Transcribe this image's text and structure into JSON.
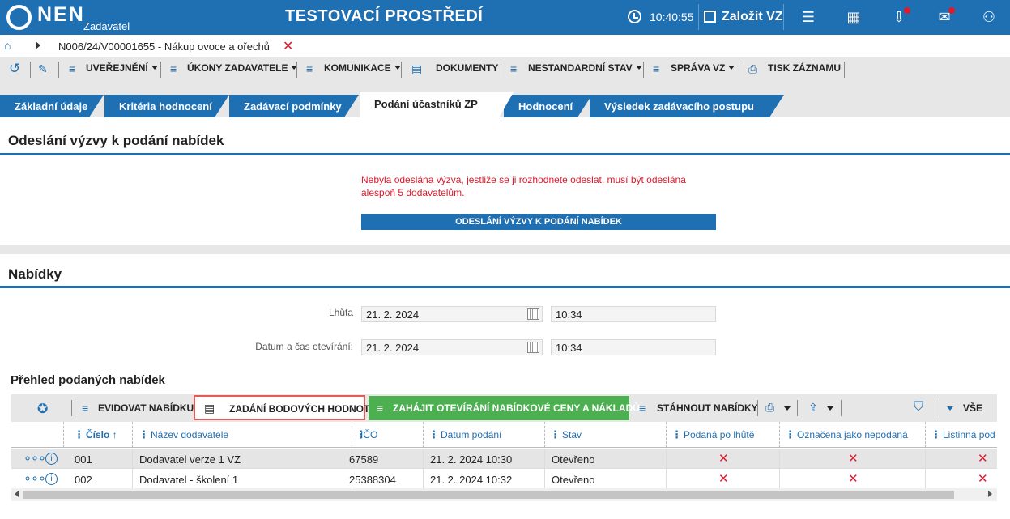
{
  "header": {
    "logo_text": "NEN",
    "logo_sub": "Zadavatel",
    "env_title": "TESTOVACÍ PROSTŘEDÍ",
    "clock": "10:40:55",
    "create_label": "Založit VZ",
    "icons": [
      "menu-icon",
      "calculator-icon",
      "inbox-icon",
      "mail-icon",
      "user-icon"
    ]
  },
  "breadcrumb": {
    "text": "N006/24/V00001655 - Nákup ovoce a ořechů",
    "close": "✕"
  },
  "toolbar": {
    "items": [
      "UVEŘEJNĚNÍ",
      "ÚKONY ZADAVATELE",
      "KOMUNIKACE",
      "DOKUMENTY",
      "NESTANDARDNÍ STAV",
      "SPRÁVA VZ",
      "TISK ZÁZNAMU"
    ]
  },
  "tabs": [
    {
      "label": "Základní údaje",
      "active": false
    },
    {
      "label": "Kritéria hodnocení",
      "active": false
    },
    {
      "label": "Zadávací podmínky",
      "active": false
    },
    {
      "label": "Podání účastníků ZP",
      "active": true
    },
    {
      "label": "Hodnocení",
      "active": false
    },
    {
      "label": "Výsledek zadávacího postupu",
      "active": false
    }
  ],
  "invite_section": {
    "title": "Odeslání výzvy k podání nabídek",
    "warning": "Nebyla odeslána výzva, jestliže se ji rozhodnete odeslat, musí být odeslána alespoň 5 dodavatelům.",
    "button": "ODESLÁNÍ VÝZVY K PODÁNÍ NABÍDEK"
  },
  "offers_section": {
    "title": "Nabídky",
    "deadline_label": "Lhůta",
    "deadline_date": "21. 2. 2024",
    "deadline_time": "10:34",
    "opening_label": "Datum a čas otevírání:",
    "opening_date": "21. 2. 2024",
    "opening_time": "10:34",
    "overview_title": "Přehled podaných nabídek"
  },
  "grid_toolbar": {
    "record": "EVIDOVAT NABÍDKU",
    "score": "ZADÁNÍ BODOVÝCH HODNOT",
    "open": "ZAHÁJIT OTEVÍRÁNÍ NABÍDKOVÉ CENY A NÁKLADŮ",
    "download": "STÁHNOUT NABÍDKY",
    "all": "VŠE"
  },
  "grid": {
    "columns": [
      "Číslo",
      "Název dodavatele",
      "IČO",
      "Datum podání",
      "Stav",
      "Podaná po lhůtě",
      "Označena jako nepodaná",
      "Listinná pod"
    ],
    "rows": [
      {
        "cislo": "001",
        "nazev": "Dodavatel verze 1 VZ",
        "ico": "67589",
        "datum": "21. 2. 2024 10:30",
        "stav": "Otevřeno",
        "po_lhute": "✕",
        "nepodana": "✕",
        "listinna": "✕"
      },
      {
        "cislo": "002",
        "nazev": "Dodavatel - školení 1",
        "ico": "25388304",
        "datum": "21. 2. 2024 10:32",
        "stav": "Otevřeno",
        "po_lhute": "✕",
        "nepodana": "✕",
        "listinna": "✕"
      }
    ]
  },
  "colors": {
    "brand_blue": "#1f6fb3",
    "error_red": "#e0192b",
    "action_green": "#4caf50",
    "highlight_red": "#e35a5a"
  }
}
